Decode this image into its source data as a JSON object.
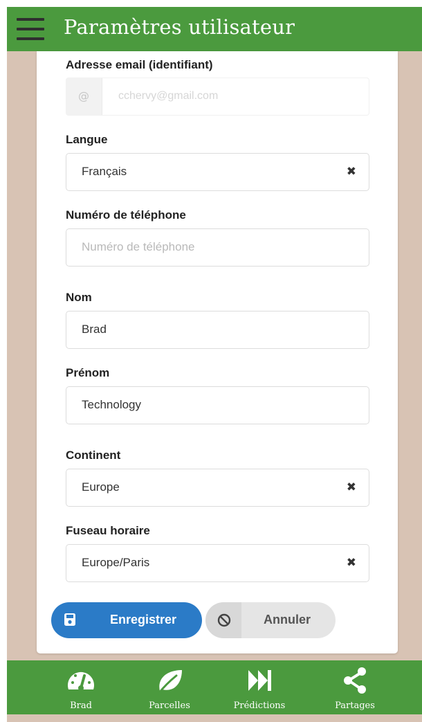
{
  "header": {
    "title": "Paramètres utilisateur",
    "menu_icon": "hamburger-menu-icon"
  },
  "form": {
    "email": {
      "label": "Adresse email (identifiant)",
      "addon": "@",
      "value": "cchervy@gmail.com"
    },
    "language": {
      "label": "Langue",
      "value": "Français",
      "clear": "✖"
    },
    "phone": {
      "label": "Numéro de téléphone",
      "placeholder": "Numéro de téléphone"
    },
    "last_name": {
      "label": "Nom",
      "value": "Brad"
    },
    "first_name": {
      "label": "Prénom",
      "value": "Technology"
    },
    "continent": {
      "label": "Continent",
      "value": "Europe",
      "clear": "✖"
    },
    "timezone": {
      "label": "Fuseau horaire",
      "value": "Europe/Paris",
      "clear": "✖"
    }
  },
  "actions": {
    "save_label": "Enregistrer",
    "cancel_label": "Annuler"
  },
  "nav": {
    "items": [
      {
        "label": "Brad",
        "icon": "dashboard-gauge-icon"
      },
      {
        "label": "Parcelles",
        "icon": "leaf-icon"
      },
      {
        "label": "Prédictions",
        "icon": "fast-forward-icon"
      },
      {
        "label": "Partages",
        "icon": "share-icon"
      }
    ]
  },
  "colors": {
    "primary_green": "#4b9a3e",
    "background_beige": "#d8c3b4",
    "save_blue": "#2b7bc7",
    "cancel_gray": "#e5e5e5"
  }
}
